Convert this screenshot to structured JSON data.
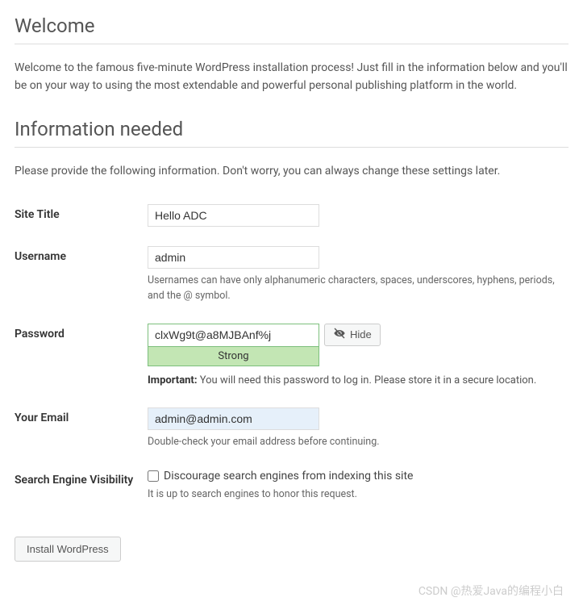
{
  "heading1": "Welcome",
  "intro": "Welcome to the famous five-minute WordPress installation process! Just fill in the information below and you'll be on your way to using the most extendable and powerful personal publishing platform in the world.",
  "heading2": "Information needed",
  "desc": "Please provide the following information. Don't worry, you can always change these settings later.",
  "site_title": {
    "label": "Site Title",
    "value": "Hello ADC"
  },
  "username": {
    "label": "Username",
    "value": "admin",
    "hint": "Usernames can have only alphanumeric characters, spaces, underscores, hyphens, periods, and the @ symbol."
  },
  "password": {
    "label": "Password",
    "value": "clxWg9t@a8MJBAnf%j",
    "strength": "Strong",
    "hide_label": "Hide",
    "important_label": "Important:",
    "important_text": " You will need this password to log in. Please store it in a secure location."
  },
  "email": {
    "label": "Your Email",
    "value": "admin@admin.com",
    "hint": "Double-check your email address before continuing."
  },
  "visibility": {
    "label": "Search Engine Visibility",
    "checkbox_label": "Discourage search engines from indexing this site",
    "hint": "It is up to search engines to honor this request."
  },
  "submit_label": "Install WordPress",
  "watermark": "CSDN @热爱Java的编程小白"
}
